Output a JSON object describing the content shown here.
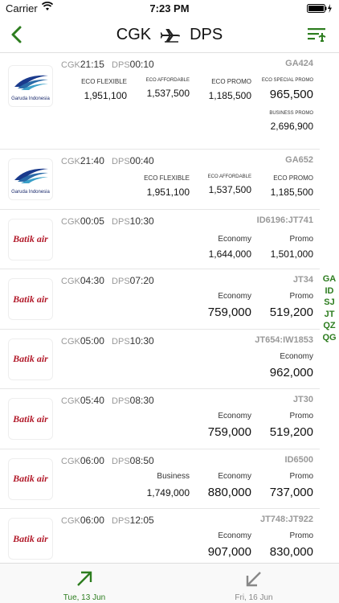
{
  "status_bar": {
    "carrier": "Carrier",
    "time": "7:23 PM"
  },
  "header": {
    "origin": "CGK",
    "destination": "DPS"
  },
  "flights": [
    {
      "airline": "Garuda Indonesia",
      "dep_code": "CGK",
      "dep_time": "21:15",
      "arr_code": "DPS",
      "arr_time": "00:10",
      "flight_no": "GA424",
      "fares": [
        {
          "label": "ECO FLEXIBLE",
          "price": "1,951,100"
        },
        {
          "label": "ECO AFFORDABLE",
          "price": "1,537,500"
        },
        {
          "label": "ECO PROMO",
          "price": "1,185,500"
        },
        {
          "label": "ECO SPECIAL PROMO",
          "price": "965,500"
        },
        {
          "label": "BUSINESS PROMO",
          "price": "2,696,900"
        }
      ]
    },
    {
      "airline": "Garuda Indonesia",
      "dep_code": "CGK",
      "dep_time": "21:40",
      "arr_code": "DPS",
      "arr_time": "00:40",
      "flight_no": "GA652",
      "fares": [
        {
          "label": "ECO FLEXIBLE",
          "price": "1,951,100"
        },
        {
          "label": "ECO AFFORDABLE",
          "price": "1,537,500"
        },
        {
          "label": "ECO PROMO",
          "price": "1,185,500"
        }
      ]
    },
    {
      "airline": "Batik air",
      "dep_code": "CGK",
      "dep_time": "00:05",
      "arr_code": "DPS",
      "arr_time": "10:30",
      "flight_no": "ID6196:JT741",
      "fares": [
        {
          "label": "Economy",
          "price": "1,644,000"
        },
        {
          "label": "Promo",
          "price": "1,501,000"
        }
      ]
    },
    {
      "airline": "Batik air",
      "dep_code": "CGK",
      "dep_time": "04:30",
      "arr_code": "DPS",
      "arr_time": "07:20",
      "flight_no": "JT34",
      "fares": [
        {
          "label": "Economy",
          "price": "759,000"
        },
        {
          "label": "Promo",
          "price": "519,200"
        }
      ]
    },
    {
      "airline": "Batik air",
      "dep_code": "CGK",
      "dep_time": "05:00",
      "arr_code": "DPS",
      "arr_time": "10:30",
      "flight_no": "JT654:IW1853",
      "fares": [
        {
          "label": "Economy",
          "price": "962,000"
        }
      ]
    },
    {
      "airline": "Batik air",
      "dep_code": "CGK",
      "dep_time": "05:40",
      "arr_code": "DPS",
      "arr_time": "08:30",
      "flight_no": "JT30",
      "fares": [
        {
          "label": "Economy",
          "price": "759,000"
        },
        {
          "label": "Promo",
          "price": "519,200"
        }
      ]
    },
    {
      "airline": "Batik air",
      "dep_code": "CGK",
      "dep_time": "06:00",
      "arr_code": "DPS",
      "arr_time": "08:50",
      "flight_no": "ID6500",
      "fares": [
        {
          "label": "Business",
          "price": "1,749,000"
        },
        {
          "label": "Economy",
          "price": "880,000"
        },
        {
          "label": "Promo",
          "price": "737,000"
        }
      ]
    },
    {
      "airline": "Batik air",
      "dep_code": "CGK",
      "dep_time": "06:00",
      "arr_code": "DPS",
      "arr_time": "12:05",
      "flight_no": "JT748:JT922",
      "fares": [
        {
          "label": "Economy",
          "price": "907,000"
        },
        {
          "label": "Promo",
          "price": "830,000"
        }
      ]
    }
  ],
  "index": [
    "GA",
    "ID",
    "SJ",
    "JT",
    "QZ",
    "QG"
  ],
  "footer": {
    "prev_date": "Tue, 13 Jun",
    "next_date": "Fri, 16 Jun"
  },
  "colors": {
    "accent": "#2d7d1f",
    "batik_red": "#b21a2a",
    "garuda_blue": "#1a2a6c"
  }
}
